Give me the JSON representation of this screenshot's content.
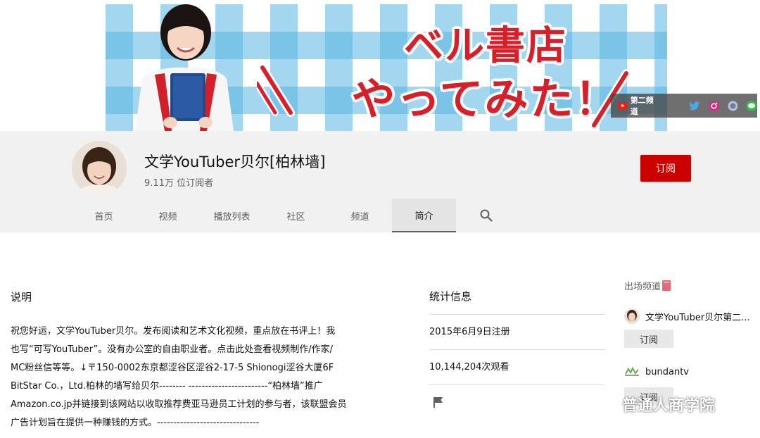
{
  "banner": {
    "title_line1": "ベル書店",
    "title_line2": "やってみた！",
    "second_channel_label": "第二频道",
    "social_links": [
      "youtube-icon",
      "twitter-icon",
      "instagram-icon",
      "globe-icon",
      "line-icon"
    ]
  },
  "channel": {
    "name": "文学YouTuber贝尔[柏林墙]",
    "subscribers": "9.11万 位订阅者",
    "subscribe_label": "订阅"
  },
  "tabs": [
    {
      "label": "首页",
      "active": false
    },
    {
      "label": "视频",
      "active": false
    },
    {
      "label": "播放列表",
      "active": false
    },
    {
      "label": "社区",
      "active": false
    },
    {
      "label": "频道",
      "active": false
    },
    {
      "label": "简介",
      "active": true
    }
  ],
  "about": {
    "description_heading": "说明",
    "description": "祝您好运，文学YouTuber贝尔。发布阅读和艺术文化视频，重点放在书评上！我\n也写“可写YouTuber”。没有办公室的自由职业者。点击此处查看视频制作/作家/\nMC粉丝信等等。↓〒150-0002东京都涩谷区涩谷2-17-5 Shionogi涩谷大厦6F\nBitStar Co.，Ltd.柏林的墙写给贝尔-------- ------------------------“柏林墙”推广\nAmazon.co.jp并链接到该网站以收取推荐费亚马逊员工计划的参与者，该联盟会员\n广告计划旨在提供一种赚钱的方式。-------------------------------"
  },
  "stats": {
    "heading": "统计信息",
    "joined": "2015年6月9日注册",
    "views": "10,144,204次观看"
  },
  "featured": {
    "heading": "出场频道",
    "channels": [
      {
        "name": "文学YouTuber贝尔第二...",
        "subscribe_label": "订阅"
      },
      {
        "name": "bundantv",
        "subscribe_label": "订阅"
      }
    ]
  },
  "watermark": "普通人商学院",
  "colors": {
    "brand_red": "#cc0000",
    "banner_red": "#d71f2a",
    "banner_blue": "#58b4e2"
  }
}
